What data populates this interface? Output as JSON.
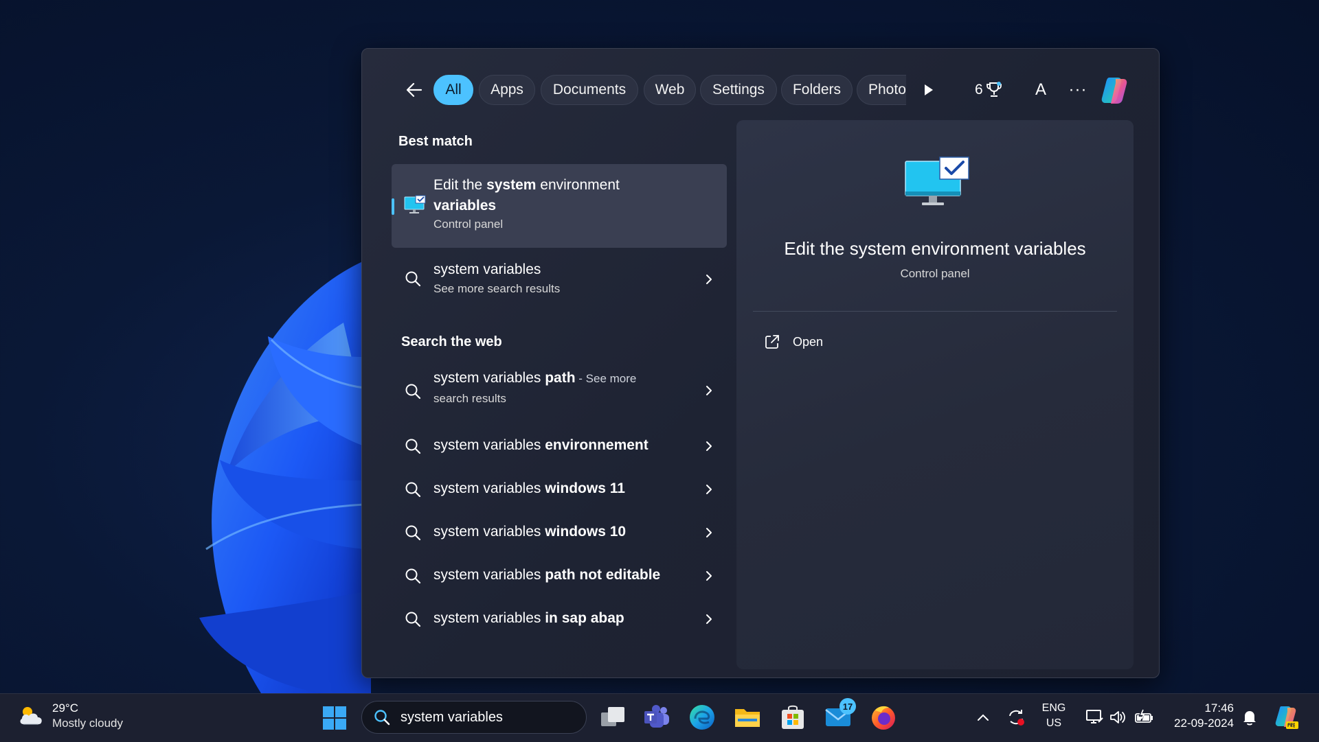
{
  "search_flyout": {
    "filters": [
      "All",
      "Apps",
      "Documents",
      "Web",
      "Settings",
      "Folders",
      "Photo"
    ],
    "active_filter": "All",
    "points": "6",
    "avatar_letter": "A",
    "more_label": "···",
    "best_match": {
      "section_title": "Best match",
      "title_prefix": "Edit the ",
      "title_bold": "system",
      "title_rest": " environment",
      "title_line2": "variables",
      "subtitle": "Control panel"
    },
    "system_variables_result": {
      "title": "system variables",
      "subtitle": "See more search results"
    },
    "web_section_title": "Search the web",
    "web_results": [
      {
        "prefix": "system variables",
        "bold": " path",
        "suffix": " - See more",
        "line2": "search results"
      },
      {
        "prefix": "system variables ",
        "bold": "environnement"
      },
      {
        "prefix": "system variables ",
        "bold": "windows 11"
      },
      {
        "prefix": "system variables ",
        "bold": "windows 10"
      },
      {
        "prefix": "system variables ",
        "bold": "path not editable"
      },
      {
        "prefix": "system variables ",
        "bold": "in sap abap"
      }
    ],
    "preview": {
      "title": "Edit the system environment variables",
      "subtitle": "Control panel",
      "open_label": "Open"
    }
  },
  "taskbar": {
    "weather_temp": "29°C",
    "weather_condition": "Mostly cloudy",
    "search_value": "system variables",
    "mail_badge": "17",
    "language_line1": "ENG",
    "language_line2": "US",
    "time": "17:46",
    "date": "22-09-2024"
  },
  "colors": {
    "accent": "#4cc2ff",
    "flyout_bg": "#1e2333",
    "taskbar_bg": "#1c2030"
  }
}
